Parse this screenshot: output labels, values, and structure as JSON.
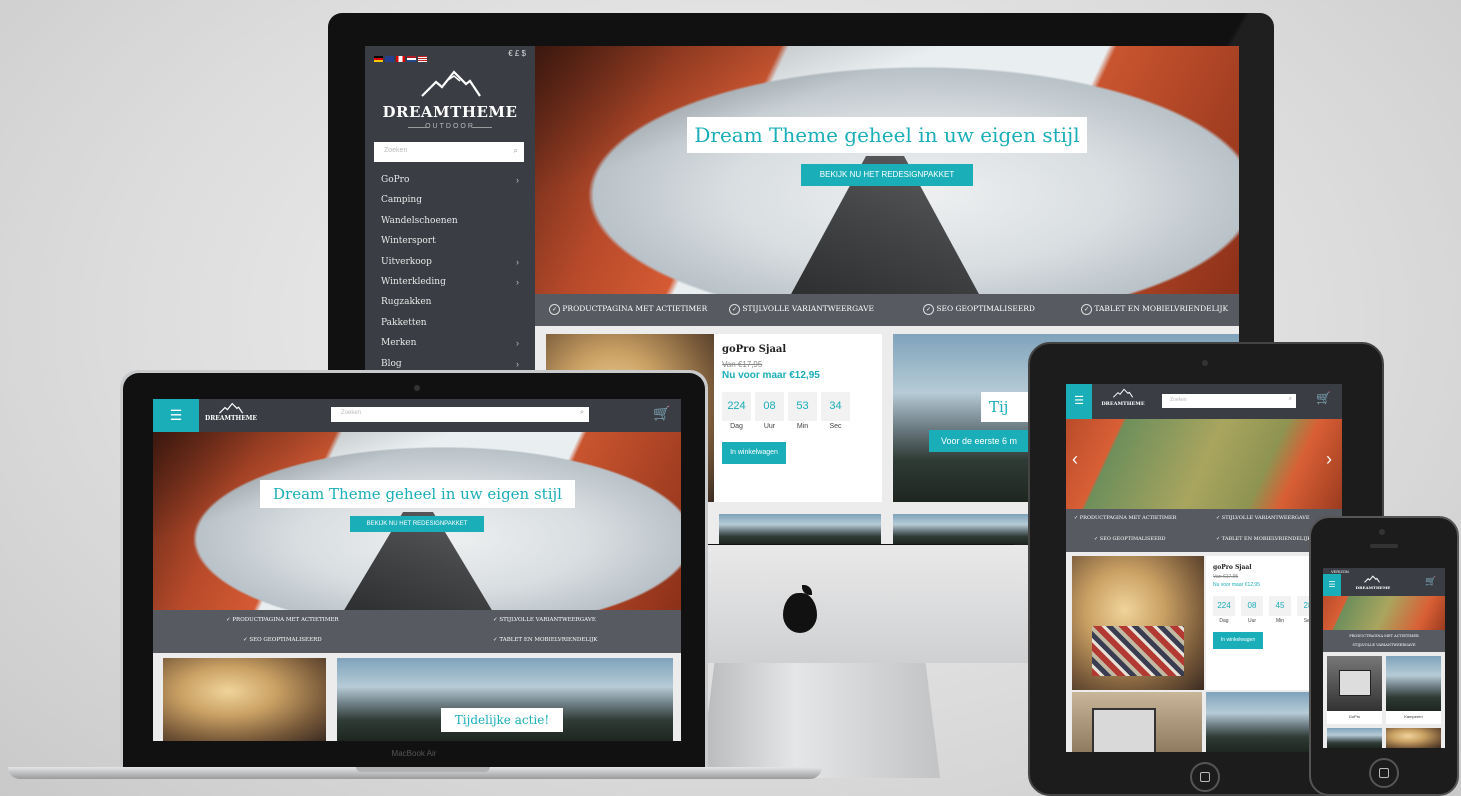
{
  "brand": {
    "name": "DREAMTHEME",
    "sub": "OUTDOOR"
  },
  "currency": "€ £ $",
  "search": {
    "placeholder": "Zoeken"
  },
  "nav": [
    {
      "label": "GoPro",
      "arrow": true
    },
    {
      "label": "Camping",
      "arrow": false
    },
    {
      "label": "Wandelschoenen",
      "arrow": false
    },
    {
      "label": "Wintersport",
      "arrow": false
    },
    {
      "label": "Uitverkoop",
      "arrow": true
    },
    {
      "label": "Winterkleding",
      "arrow": true
    },
    {
      "label": "Rugzakken",
      "arrow": false
    },
    {
      "label": "Pakketten",
      "arrow": false
    },
    {
      "label": "Merken",
      "arrow": true
    },
    {
      "label": "Blog",
      "arrow": true
    }
  ],
  "hero": {
    "title": "Dream Theme geheel in uw eigen stijl",
    "cta": "BEKIJK NU HET REDESIGNPAKKET"
  },
  "features": [
    "PRODUCTPAGINA MET ACTIETIMER",
    "STIJLVOLLE VARIANTWEERGAVE",
    "SEO GEOPTIMALISEERD",
    "TABLET EN MOBIELVRIENDELIJK"
  ],
  "features_tablet": [
    "PRODUCTPAGINA MET ACTIETIMER",
    "STIJLVOLLE VARIANTWEERGAVE",
    "SEO GEOPTIMALISEERD",
    "TABLET EN MOBIELVRIENDELIJK"
  ],
  "product": {
    "name": "goPro Sjaal",
    "old_price": "Van €17,95",
    "new_price": "Nu voor maar €12,95",
    "countdown": [
      {
        "value": "224",
        "label": "Dag"
      },
      {
        "value": "08",
        "label": "Uur"
      },
      {
        "value": "53",
        "label": "Min"
      },
      {
        "value": "34",
        "label": "Sec"
      }
    ],
    "cart_button": "In winkelwagen"
  },
  "tablet_countdown": [
    "224",
    "08",
    "45",
    "28"
  ],
  "promo": {
    "title_partial": "Tij",
    "subtitle_partial": "Voor de eerste 6 m"
  },
  "laptop_promo": "Tijdelijke actie!",
  "laptop_label": "MacBook Air",
  "phone": {
    "carrier": "VERIZON",
    "features": [
      "PRODUCTPAGINA MET ACTIETIMER",
      "STIJLVOLLE VARIANTWEERGAVE"
    ],
    "tiles": [
      "GoPro",
      "Kamperen"
    ]
  },
  "colors": {
    "accent": "#1aaeb8",
    "dark_panel": "#3a3d44",
    "feature_bar": "#575a60"
  }
}
